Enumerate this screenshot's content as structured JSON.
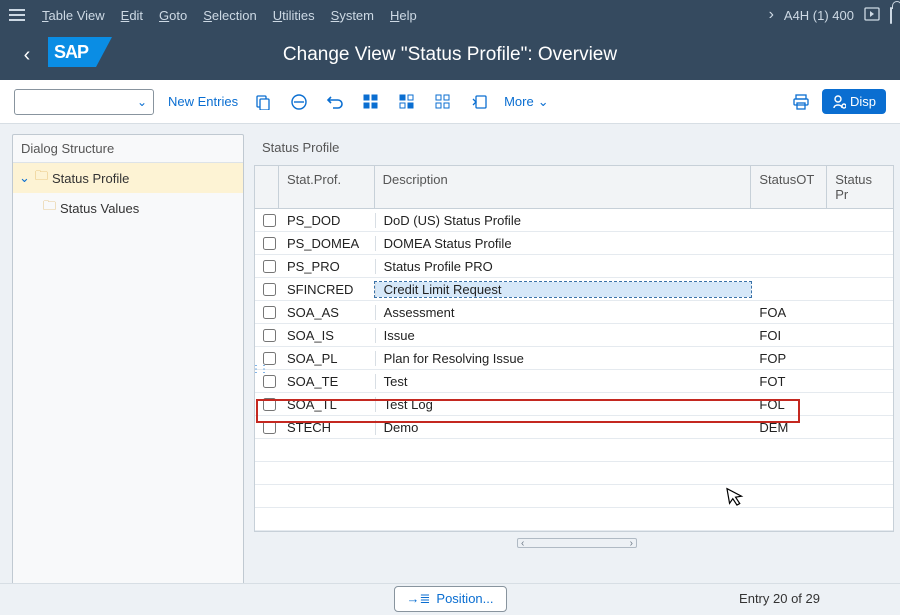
{
  "top_menu": {
    "items": [
      "Table View",
      "Edit",
      "Goto",
      "Selection",
      "Utilities",
      "System",
      "Help"
    ],
    "system": "A4H (1) 400"
  },
  "header": {
    "title": "Change View \"Status Profile\": Overview"
  },
  "toolbar": {
    "new_entries": "New Entries",
    "more": "More",
    "display_btn": "Disp"
  },
  "tree": {
    "title": "Dialog Structure",
    "node1": "Status Profile",
    "node2": "Status Values"
  },
  "section": {
    "title": "Status Profile"
  },
  "columns": {
    "c1": "Stat.Prof.",
    "c2": "Description",
    "c3": "StatusOT",
    "c4": "Status Pr"
  },
  "rows": [
    {
      "prof": "PS_DOD",
      "desc": "DoD (US) Status Profile",
      "ot": ""
    },
    {
      "prof": "PS_DOMEA",
      "desc": "DOMEA Status Profile",
      "ot": ""
    },
    {
      "prof": "PS_PRO",
      "desc": "Status Profile PRO",
      "ot": ""
    },
    {
      "prof": "SFINCRED",
      "desc": "Credit Limit Request",
      "ot": "",
      "editing": true
    },
    {
      "prof": "SOA_AS",
      "desc": "Assessment",
      "ot": "FOA"
    },
    {
      "prof": "SOA_IS",
      "desc": "Issue",
      "ot": "FOI"
    },
    {
      "prof": "SOA_PL",
      "desc": "Plan for Resolving Issue",
      "ot": "FOP"
    },
    {
      "prof": "SOA_TE",
      "desc": "Test",
      "ot": "FOT"
    },
    {
      "prof": "SOA_TL",
      "desc": "Test Log",
      "ot": "FOL"
    },
    {
      "prof": "STECH",
      "desc": "Demo",
      "ot": "DEM",
      "hl": true
    }
  ],
  "footer": {
    "position": "Position...",
    "entry": "Entry 20 of 29"
  }
}
